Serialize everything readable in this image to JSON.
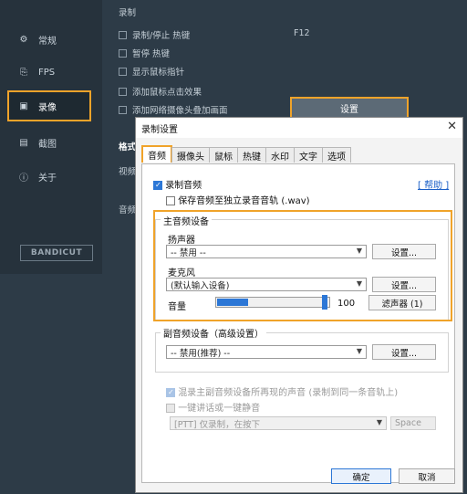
{
  "background": {
    "sidebar": {
      "items": [
        {
          "label": "常规",
          "icon": "gear-icon"
        },
        {
          "label": "FPS",
          "icon": "fps-icon"
        },
        {
          "label": "录像",
          "icon": "record-video-icon",
          "active": true
        },
        {
          "label": "截图",
          "icon": "image-icon"
        },
        {
          "label": "关于",
          "icon": "info-icon"
        }
      ],
      "logo": "BANDICUT"
    },
    "section_title": "录制",
    "checks": [
      {
        "label": "录制/停止 热键",
        "checked": true
      },
      {
        "label": "暂停 热键",
        "checked": false
      },
      {
        "label": "显示鼠标指针",
        "checked": false
      },
      {
        "label": "添加鼠标点击效果",
        "checked": false
      },
      {
        "label": "添加网络摄像头叠加画面",
        "checked": false
      }
    ],
    "hotkey_value": "F12",
    "settings_button": "设置",
    "format_label": "格式",
    "video_label": "视频",
    "audio_label": "音频"
  },
  "dialog": {
    "title": "录制设置",
    "close": "✕",
    "tabs": [
      "音频",
      "摄像头",
      "鼠标",
      "热键",
      "水印",
      "文字",
      "选项"
    ],
    "active_tab": "音频",
    "record_audio": {
      "label": "录制音频",
      "checked": true
    },
    "save_separate": {
      "label": "保存音频至独立录音音轨 (.wav)",
      "checked": false
    },
    "help_link": "[ 帮助 ]",
    "main_device": {
      "title": "主音频设备",
      "speaker_label": "扬声器",
      "speaker_value": "-- 禁用 --",
      "speaker_button": "设置...",
      "mic_label": "麦克风",
      "mic_value": "(默认输入设备)",
      "mic_button": "设置...",
      "volume_label": "音量",
      "volume_value": "100",
      "volume_fraction": 0.28,
      "filter_button": "滤声器 (1)"
    },
    "secondary_device": {
      "title": "副音频设备（高级设置）",
      "value": "-- 禁用(推荐) --",
      "button": "设置..."
    },
    "mix_option": {
      "label": "混录主副音频设备所再现的声音 (录制到同一条音轨上)",
      "checked": true,
      "disabled": true
    },
    "ptt_option": {
      "label": "一键讲话或一键静音",
      "checked": false
    },
    "ptt_select": "[PTT] 仅录制，在按下",
    "ptt_key": "Space",
    "ok": "确定",
    "cancel": "取消"
  },
  "colors": {
    "accent": "#f0a32a",
    "primary": "#2c77d6"
  }
}
